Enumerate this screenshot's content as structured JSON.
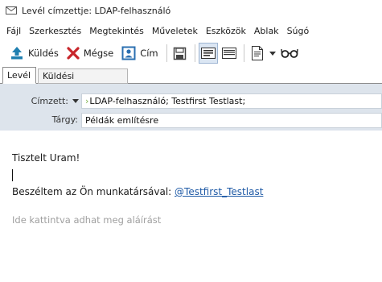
{
  "window": {
    "title": "Levél címzettje: LDAP-felhasználó"
  },
  "menu": [
    "Fájl",
    "Szerkesztés",
    "Megtekintés",
    "Műveletek",
    "Eszközök",
    "Ablak",
    "Súgó"
  ],
  "toolbar": {
    "send_label": "Küldés",
    "cancel_label": "Mégse",
    "address_label": "Cím"
  },
  "tabs": {
    "message": "Levél",
    "send_options": "Küldési beállítások"
  },
  "header": {
    "to_label": "Címzett:",
    "to_value": "LDAP-felhasználó;  Testfirst Testlast;",
    "subject_label": "Tárgy:",
    "subject_value": "Példák említésre"
  },
  "body": {
    "greeting": "Tisztelt Uram!",
    "mention_prefix": "Beszéltem az Ön munkatársával: ",
    "mention": "@Testfirst_Testlast",
    "signature_placeholder": "Ide kattintva adhat meg aláírást"
  },
  "colors": {
    "header_bg": "#dde4ec",
    "mention": "#1f5aa6",
    "send_icon": "#1f7fb0",
    "cancel_icon": "#c8262b"
  }
}
